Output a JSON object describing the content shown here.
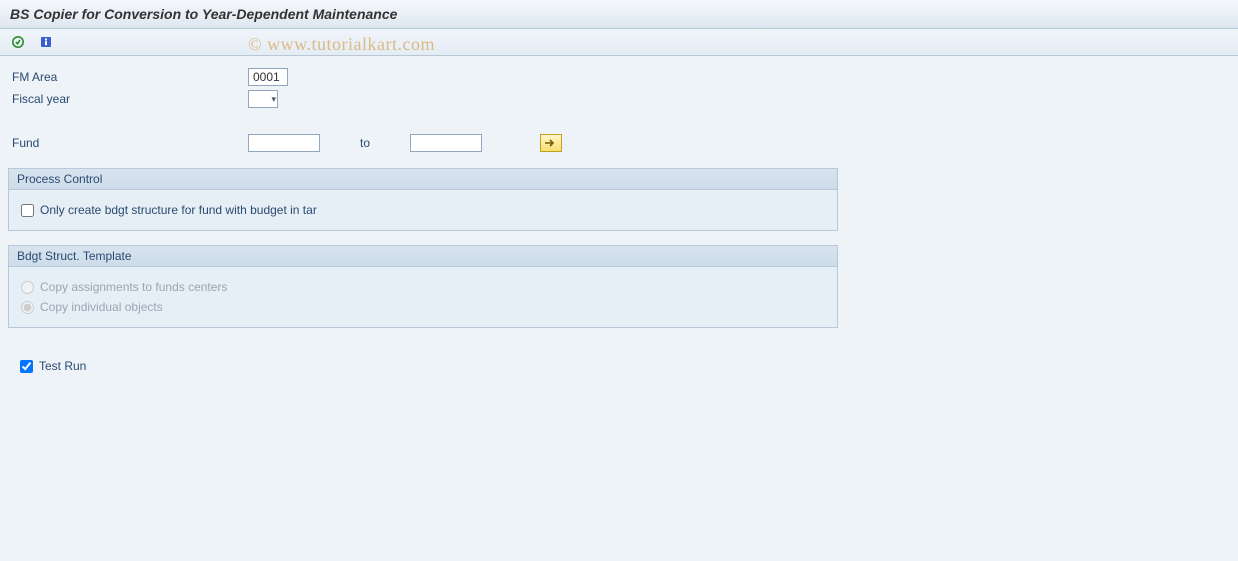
{
  "title": "BS Copier for Conversion to Year-Dependent Maintenance",
  "watermark": "© www.tutorialkart.com",
  "fields": {
    "fm_area": {
      "label": "FM Area",
      "value": "0001"
    },
    "fiscal_year": {
      "label": "Fiscal year",
      "value": ""
    },
    "fund": {
      "label": "Fund",
      "from": "",
      "to_label": "to",
      "to": ""
    }
  },
  "process_control": {
    "title": "Process Control",
    "only_create": {
      "label": "Only create bdgt structure for fund with budget in tar",
      "checked": false
    }
  },
  "template": {
    "title": "Bdgt Struct. Template",
    "copy_assignments": {
      "label": "Copy assignments to funds centers",
      "checked": false,
      "disabled": true
    },
    "copy_individual": {
      "label": "Copy individual objects",
      "checked": true,
      "disabled": true
    }
  },
  "test_run": {
    "label": "Test Run",
    "checked": true
  }
}
